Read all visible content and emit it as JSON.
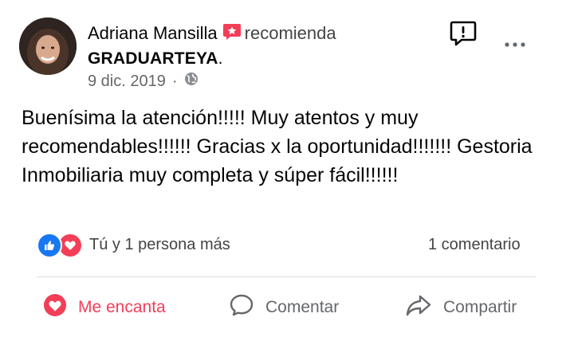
{
  "post": {
    "author": "Adriana Mansilla",
    "verb": "recomienda",
    "page": "GRADUARTEYA",
    "page_suffix": ".",
    "date": "9 dic. 2019",
    "separator": "·",
    "text": "Buenísima la atención!!!!! Muy atentos y muy recomendables!!!!!! Gracias x la oportunidad!!!!!!! Gestoria Inmobiliaria muy completa y súper fácil!!!!!!"
  },
  "reactions": {
    "icons": [
      "like-icon",
      "love-icon"
    ],
    "summary": "Tú y 1 persona más",
    "comments": "1 comentario"
  },
  "actions": {
    "love": "Me encanta",
    "comment": "Comentar",
    "share": "Compartir"
  },
  "colors": {
    "love": "#f33e58",
    "like": "#1877f2",
    "secondary_text": "#65676b",
    "divider": "#dadde1"
  }
}
